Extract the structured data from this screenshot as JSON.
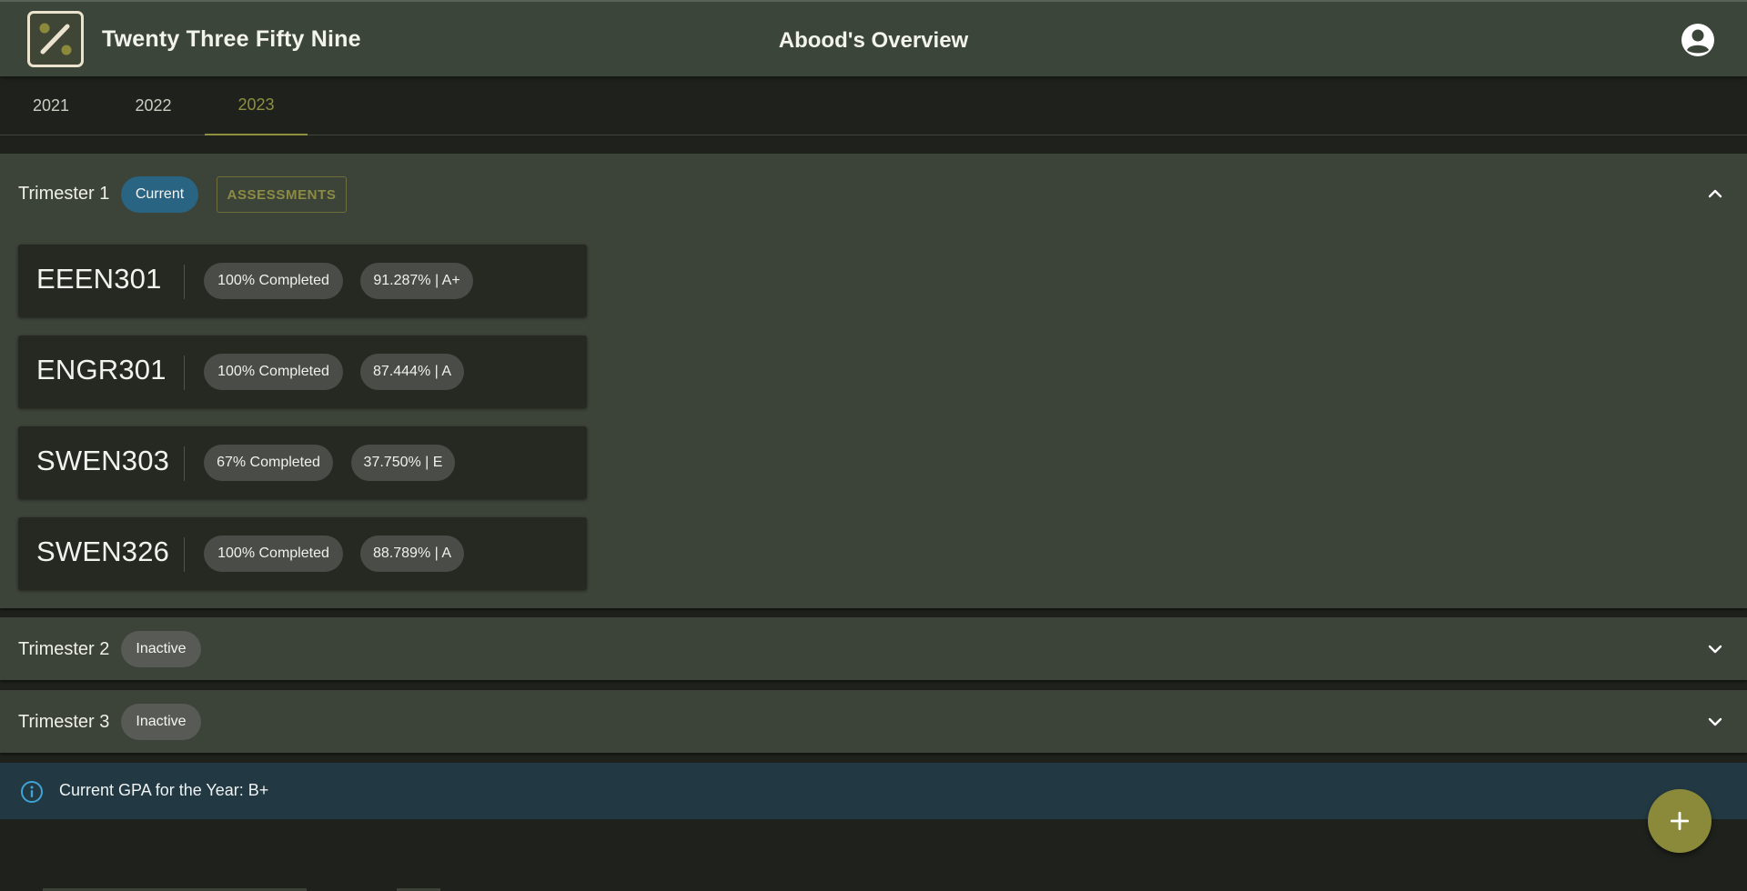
{
  "app": {
    "name": "Twenty Three Fifty Nine",
    "page_title": "Abood's Overview"
  },
  "year_tabs": [
    {
      "label": "2021",
      "active": false
    },
    {
      "label": "2022",
      "active": false
    },
    {
      "label": "2023",
      "active": true
    }
  ],
  "trimesters": [
    {
      "label": "Trimester 1",
      "status": "Current",
      "assessments_label": "ASSESSMENTS",
      "expanded": true,
      "courses": [
        {
          "code": "EEEN301",
          "completion": "100% Completed",
          "grade": "91.287% | A+"
        },
        {
          "code": "ENGR301",
          "completion": "100% Completed",
          "grade": "87.444% | A"
        },
        {
          "code": "SWEN303",
          "completion": "67% Completed",
          "grade": "37.750% | E"
        },
        {
          "code": "SWEN326",
          "completion": "100% Completed",
          "grade": "88.789% | A"
        }
      ]
    },
    {
      "label": "Trimester 2",
      "status": "Inactive",
      "expanded": false
    },
    {
      "label": "Trimester 3",
      "status": "Inactive",
      "expanded": false
    }
  ],
  "gpa": {
    "text": "Current GPA for the Year: B+"
  },
  "icons": {
    "logo": "percent-logo-icon",
    "account": "account-circle-icon",
    "expand": "chevron-down-icon",
    "collapse": "chevron-up-icon",
    "info": "info-icon",
    "add": "plus-icon"
  },
  "colors": {
    "appbar": "#3c4539",
    "accent": "#8a8a3a",
    "current_chip": "#2a6483",
    "inactive_chip": "#585a56",
    "info_bar": "#223943"
  }
}
